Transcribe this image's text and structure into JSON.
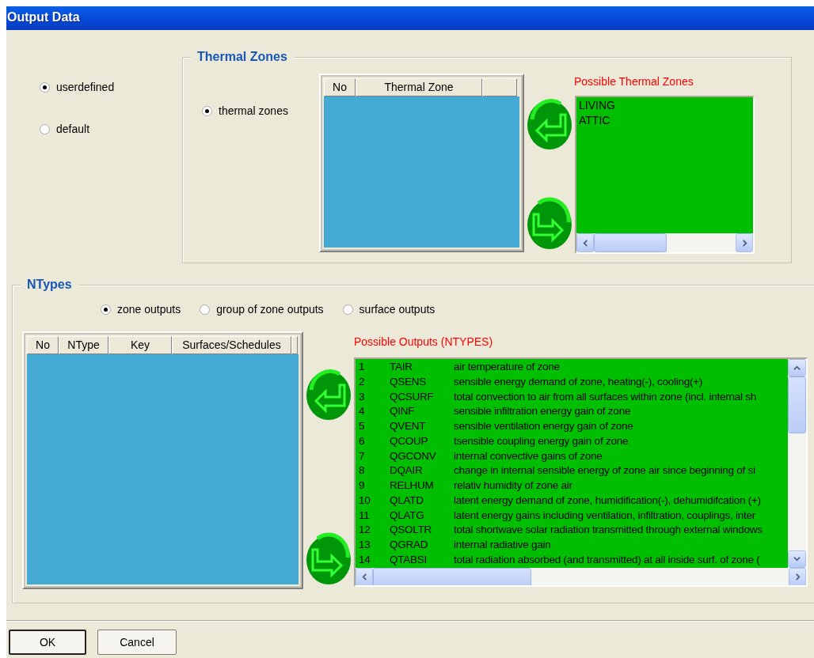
{
  "window": {
    "title": "Output Data"
  },
  "mode_options": [
    {
      "label": "userdefined",
      "selected": true
    },
    {
      "label": "default",
      "selected": false
    }
  ],
  "thermal_zones": {
    "title": "Thermal Zones",
    "options": [
      {
        "label": "thermal zones",
        "selected": true
      }
    ],
    "table": {
      "columns": [
        "No",
        "Thermal Zone",
        ""
      ]
    },
    "possible": {
      "title": "Possible Thermal Zones",
      "items": [
        "LIVING",
        "ATTIC"
      ]
    }
  },
  "ntypes": {
    "title": "NTypes",
    "options": [
      {
        "label": "zone outputs",
        "selected": true
      },
      {
        "label": "group of zone outputs",
        "selected": false
      },
      {
        "label": "surface outputs",
        "selected": false
      }
    ],
    "table": {
      "columns": [
        "No",
        "NType",
        "Key",
        "Surfaces/Schedules",
        ""
      ]
    },
    "possible": {
      "title": "Possible Outputs (NTYPES)",
      "items": [
        {
          "no": "1",
          "ntype": "TAIR",
          "description": "air temperature of zone"
        },
        {
          "no": "2",
          "ntype": "QSENS",
          "description": "sensible energy demand of zone, heating(-), cooling(+)"
        },
        {
          "no": "3",
          "ntype": "QCSURF",
          "description": "total convection to air from all surfaces within zone (incl. internal sh"
        },
        {
          "no": "4",
          "ntype": "QINF",
          "description": "sensible infiltration energy gain of zone"
        },
        {
          "no": "5",
          "ntype": "QVENT",
          "description": "sensible ventilation energy gain of zone"
        },
        {
          "no": "6",
          "ntype": "QCOUP",
          "description": "tsensible coupling energy gain of zone"
        },
        {
          "no": "7",
          "ntype": "QGCONV",
          "description": "internal convective gains of zone"
        },
        {
          "no": "8",
          "ntype": "DQAIR",
          "description": "change in internal sensible energy of zone air since beginning of si"
        },
        {
          "no": "9",
          "ntype": "RELHUM",
          "description": "relativ humidity of zone air"
        },
        {
          "no": "10",
          "ntype": "QLATD",
          "description": "latent energy demand of zone, humidification(-), dehumidifcation (+)"
        },
        {
          "no": "11",
          "ntype": "QLATG",
          "description": "latent energy gains including ventilation, infiltration, couplings, inter"
        },
        {
          "no": "12",
          "ntype": "QSOLTR",
          "description": "total shortwave solar radiation transmitted through external windows"
        },
        {
          "no": "13",
          "ntype": "QGRAD",
          "description": "internal radiative gain"
        },
        {
          "no": "14",
          "ntype": "QTABSI",
          "description": "total radiation absorbed (and transmitted) at all inside surf. of zone ("
        }
      ]
    }
  },
  "buttons": [
    {
      "label": "OK",
      "default": true
    },
    {
      "label": "Cancel",
      "default": false
    }
  ]
}
